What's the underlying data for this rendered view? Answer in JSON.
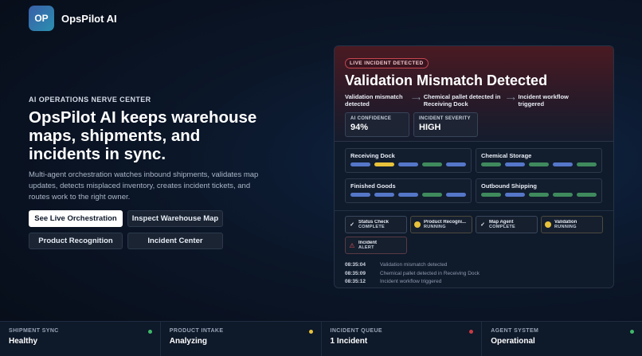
{
  "brand": {
    "initials": "OP",
    "name": "OpsPilot AI"
  },
  "hero": {
    "eyebrow": "AI OPERATIONS NERVE CENTER",
    "headline": "OpsPilot AI keeps warehouse maps, shipments, and incidents in sync.",
    "description": "Multi-agent orchestration watches inbound shipments, validates map updates, detects misplaced inventory, creates incident tickets, and routes work to the right owner.",
    "buttons": [
      {
        "label": "See Live Orchestration",
        "style": "primary"
      },
      {
        "label": "Inspect Warehouse Map",
        "style": "secondary"
      },
      {
        "label": "Product Recognition",
        "style": "secondary"
      },
      {
        "label": "Incident Center",
        "style": "secondary"
      }
    ]
  },
  "incident": {
    "badge": "LIVE INCIDENT DETECTED",
    "title": "Validation Mismatch Detected",
    "flow": [
      "Validation mismatch detected",
      "Chemical pallet detected in Receiving Dock",
      "Incident workflow triggered"
    ],
    "flow_arrow": "⟶",
    "metrics": [
      {
        "label": "AI CONFIDENCE",
        "value": "94%"
      },
      {
        "label": "INCIDENT SEVERITY",
        "value": "HIGH"
      }
    ]
  },
  "colors": {
    "blue": "#5577c9",
    "yellow": "#e8c23a",
    "green": "#3f8a5c",
    "red": "#e5525c",
    "orange": "#e8a93a"
  },
  "zones": [
    {
      "name": "Receiving Dock",
      "pills": [
        "blue",
        "yellow",
        "blue",
        "green",
        "blue"
      ]
    },
    {
      "name": "Chemical Storage",
      "pills": [
        "green",
        "blue",
        "green",
        "blue",
        "green"
      ]
    },
    {
      "name": "Finished Goods",
      "pills": [
        "blue",
        "blue",
        "blue",
        "green",
        "blue"
      ]
    },
    {
      "name": "Outbound Shipping",
      "pills": [
        "green",
        "blue",
        "green",
        "green",
        "green"
      ]
    }
  ],
  "agents": [
    {
      "name": "Status Check",
      "status": "COMPLETE",
      "icon": "check-icon",
      "state": "complete"
    },
    {
      "name": "Product Recogni...",
      "status": "RUNNING",
      "icon": "running-dot-icon",
      "state": "running"
    },
    {
      "name": "Map Agent",
      "status": "COMPLETE",
      "icon": "check-icon",
      "state": "complete"
    },
    {
      "name": "Validation",
      "status": "RUNNING",
      "icon": "running-dot-icon",
      "state": "running"
    },
    {
      "name": "Incident",
      "status": "ALERT",
      "icon": "warning-icon",
      "state": "alert"
    }
  ],
  "log": [
    {
      "time": "08:35:04",
      "message": "Validation mismatch detected"
    },
    {
      "time": "08:35:09",
      "message": "Chemical pallet detected in Receiving Dock"
    },
    {
      "time": "08:35:12",
      "message": "Incident workflow triggered"
    }
  ],
  "status_bar": [
    {
      "label": "SHIPMENT SYNC",
      "value": "Healthy",
      "dot_color": "#3fb86a"
    },
    {
      "label": "PRODUCT INTAKE",
      "value": "Analyzing",
      "dot_color": "#e8c23a"
    },
    {
      "label": "INCIDENT QUEUE",
      "value": "1 Incident",
      "dot_color": "#c93a44"
    },
    {
      "label": "AGENT SYSTEM",
      "value": "Operational",
      "dot_color": "#3fb86a"
    }
  ]
}
